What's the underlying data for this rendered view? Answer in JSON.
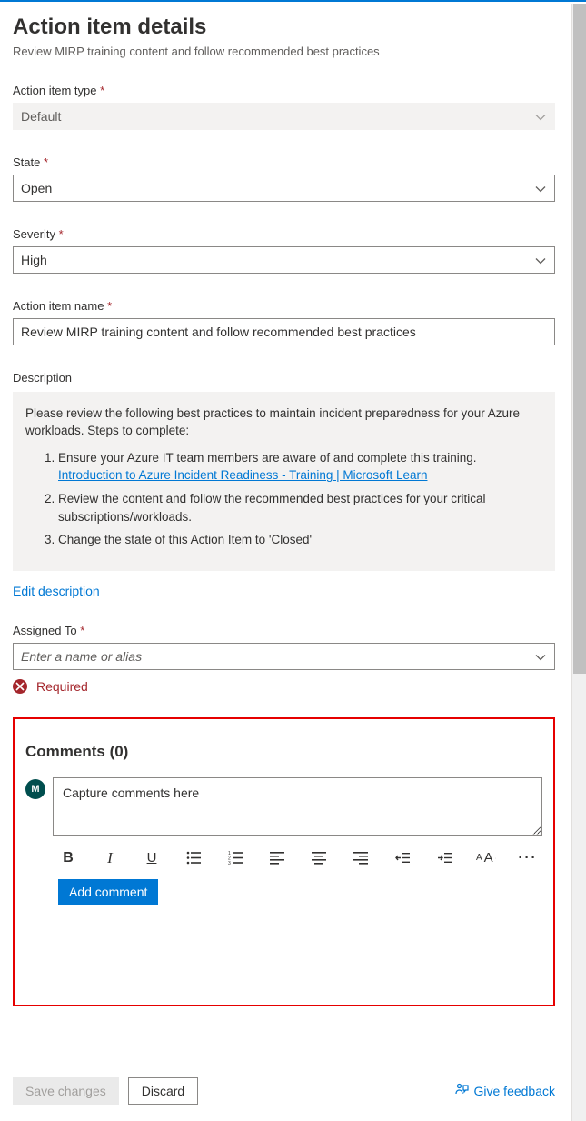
{
  "header": {
    "title": "Action item details",
    "subtitle": "Review MIRP training content and follow recommended best practices"
  },
  "fields": {
    "type": {
      "label": "Action item type",
      "value": "Default",
      "required": true
    },
    "state": {
      "label": "State",
      "value": "Open",
      "required": true
    },
    "severity": {
      "label": "Severity",
      "value": "High",
      "required": true
    },
    "name": {
      "label": "Action item name",
      "value": "Review MIRP training content and follow recommended best practices",
      "required": true
    },
    "description": {
      "label": "Description",
      "intro": "Please review the following best practices to maintain incident preparedness for your Azure workloads. Steps to complete:",
      "step1": "Ensure your Azure IT team members are aware of and complete this training.",
      "step1_link": "Introduction to Azure Incident Readiness - Training | Microsoft Learn",
      "step2": "Review the content and follow the recommended best practices for your critical subscriptions/workloads.",
      "step3": "Change the state of this Action Item to 'Closed'"
    },
    "edit_description": "Edit description",
    "assigned_to": {
      "label": "Assigned To",
      "placeholder": "Enter a name or alias",
      "required": true,
      "error": "Required"
    }
  },
  "comments": {
    "heading": "Comments (0)",
    "avatar_initial": "M",
    "placeholder": "Capture comments here",
    "add_button": "Add comment",
    "toolbar": {
      "bold": "B",
      "italic": "I",
      "underline": "U"
    }
  },
  "footer": {
    "save": "Save changes",
    "discard": "Discard",
    "feedback": "Give feedback"
  }
}
